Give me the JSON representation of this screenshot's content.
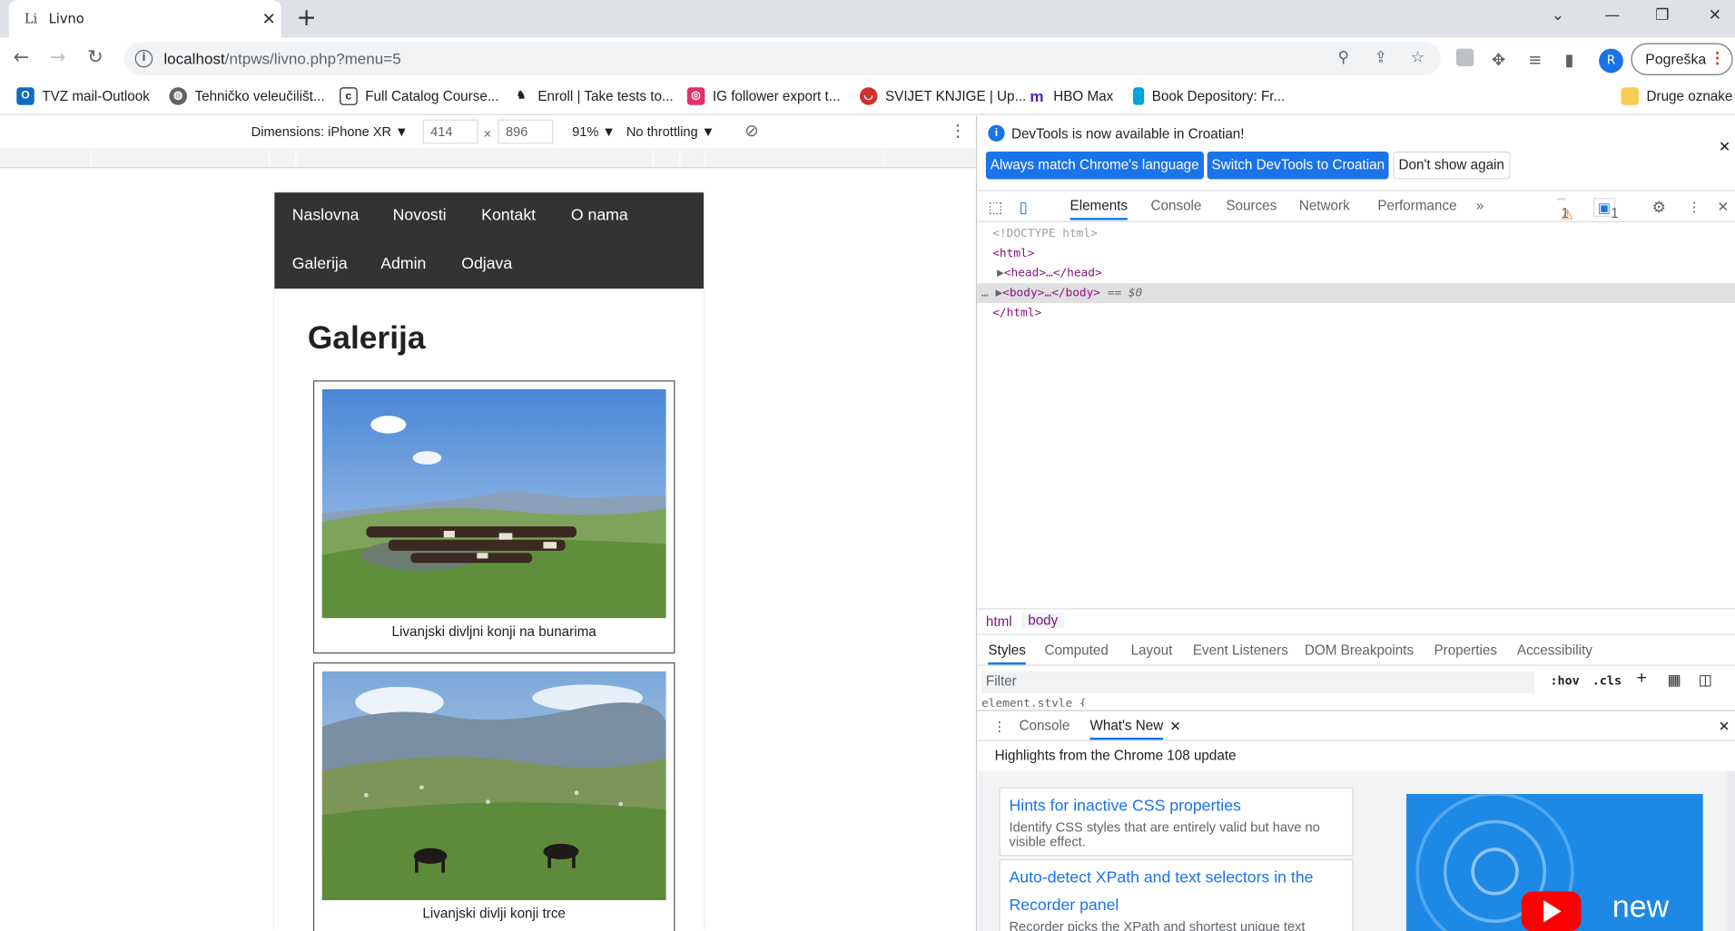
{
  "browser": {
    "tab": {
      "favicon": "Li",
      "title": "Livno"
    },
    "url_host": "localhost",
    "url_path": "/ntpws/livno.php?menu=5",
    "profile_initial": "R",
    "error_chip": "Pogreška",
    "bookmarks": [
      {
        "label": "TVZ mail-Outlook",
        "icon": "outlook-icon",
        "color": "#0f6cbd"
      },
      {
        "label": "Tehničko veleučilišt...",
        "icon": "globe-icon",
        "color": "#5f6368"
      },
      {
        "label": "Full Catalog Course...",
        "icon": "catalog-icon",
        "color": "#202124"
      },
      {
        "label": "Enroll | Take tests to...",
        "icon": "horse-icon",
        "color": "#202124"
      },
      {
        "label": "IG follower export t...",
        "icon": "instagram-icon",
        "color": "#e1306c"
      },
      {
        "label": "SVIJET KNJIGE | Up...",
        "icon": "lips-icon",
        "color": "#d32f2f"
      },
      {
        "label": "HBO Max",
        "icon": "hbo-icon",
        "color": "#5822b4"
      },
      {
        "label": "Book Depository: Fr...",
        "icon": "bookmark-icon",
        "color": "#00a3e0"
      }
    ],
    "other_bookmarks": "Druge oznake"
  },
  "device_toolbar": {
    "dimensions": "Dimensions: iPhone XR ▼",
    "width": "414",
    "times": "×",
    "height": "896",
    "zoom": "91% ▼",
    "throttling": "No throttling ▼"
  },
  "site": {
    "nav_row1": [
      "Naslovna",
      "Novosti",
      "Kontakt",
      "O nama"
    ],
    "nav_row2": [
      "Galerija",
      "Admin",
      "Odjava"
    ],
    "title": "Galerija",
    "figures": [
      {
        "caption": "Livanjski divljni konji na bunarima"
      },
      {
        "caption": "Livanjski divlji konji trce"
      }
    ]
  },
  "devtools": {
    "info_message": "DevTools is now available in Croatian!",
    "btn_match": "Always match Chrome's language",
    "btn_switch": "Switch DevTools to Croatian",
    "btn_dont": "Don't show again",
    "tabs": [
      "Elements",
      "Console",
      "Sources",
      "Network",
      "Performance"
    ],
    "warn_count": "1",
    "msg_count": "1",
    "dom": {
      "doctype": "<!DOCTYPE html>",
      "html_open": "<html>",
      "head": "<head>…</head>",
      "body": "<body>…</body>",
      "body_suffix": "== $0",
      "html_close": "</html>"
    },
    "crumbs": [
      "html",
      "body"
    ],
    "style_tabs": [
      "Styles",
      "Computed",
      "Layout",
      "Event Listeners",
      "DOM Breakpoints",
      "Properties",
      "Accessibility"
    ],
    "filter_placeholder": "Filter",
    "hov": ":hov",
    "cls": ".cls",
    "element_style": "element.style {",
    "drawer_tabs": [
      "Console",
      "What's New"
    ],
    "whats_new_heading": "Highlights from the Chrome 108 update",
    "cards": [
      {
        "title": "Hints for inactive CSS properties",
        "desc": "Identify CSS styles that are entirely valid but have no visible effect."
      },
      {
        "title": "Auto-detect XPath and text selectors in the Recorder panel",
        "desc": "Recorder picks the XPath and shortest unique text"
      }
    ],
    "thumb_label": "new"
  }
}
